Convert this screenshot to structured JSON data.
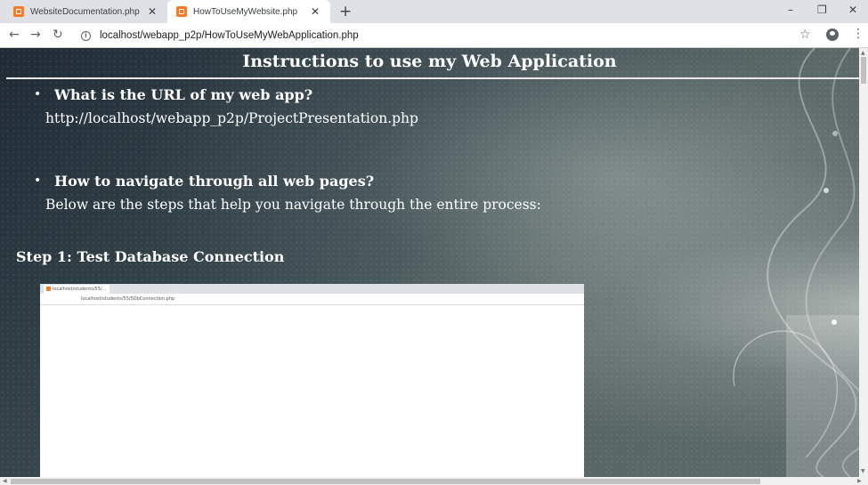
{
  "browser": {
    "tabs": [
      {
        "title": "WebsiteDocumentation.php",
        "close": "✕"
      },
      {
        "title": "HowToUseMyWebsite.php",
        "close": "✕"
      }
    ],
    "new_tab": "+",
    "window_controls": {
      "minimize": "–",
      "restore": "❐",
      "close": "✕"
    },
    "nav": {
      "back": "←",
      "forward": "→",
      "reload": "↻"
    },
    "info_icon": "i",
    "url": "localhost/webapp_p2p/HowToUseMyWebApplication.php",
    "star": "☆",
    "menu": "⋮"
  },
  "page": {
    "title": "Instructions to use my Web Application",
    "bullet": "•",
    "q1": "What is the URL of my web app?",
    "a1": "http://localhost/webapp_p2p/ProjectPresentation.php",
    "q2": "How to navigate through all web pages?",
    "a2": "Below are the steps that help you navigate through the entire process:",
    "step1": "Step 1: Test Database Connection",
    "screenshot": {
      "tab": "localhost/students/55/...",
      "url": "localhost/students/55/5DbConnection.php"
    }
  },
  "scroll": {
    "left": "◀",
    "right": "▶",
    "up": "▲",
    "down": "▼"
  }
}
